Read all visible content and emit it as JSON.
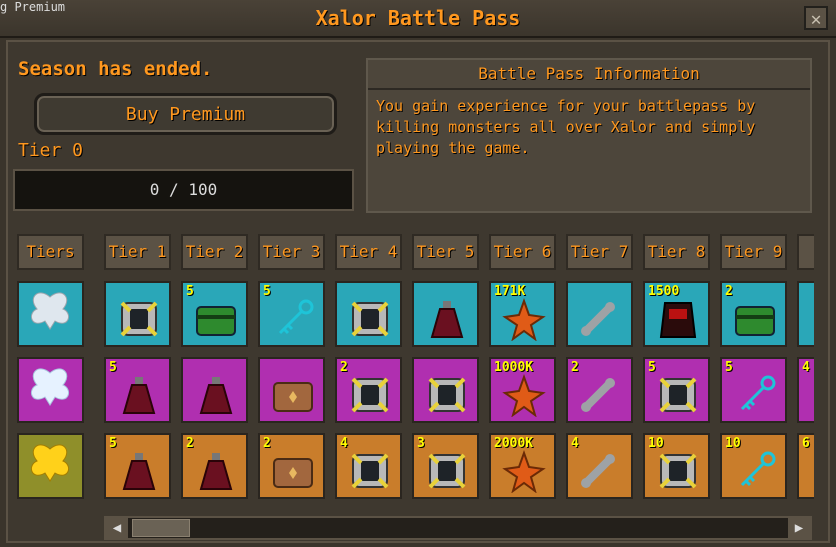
{
  "window": {
    "top_text": "g Premium",
    "title": "Xalor Battle Pass",
    "close_label": "✕"
  },
  "status": {
    "season_text": "Season has ended.",
    "buy_label": "Buy Premium",
    "tier_label": "Tier 0"
  },
  "progress": {
    "text": "0 / 100",
    "fraction": 0
  },
  "info": {
    "title": "Battle Pass Information",
    "body": "You gain experience for your battlepass by killing monsters all over Xalor and simply playing the game."
  },
  "headers": [
    "Tiers",
    "Tier 1",
    "Tier 2",
    "Tier 3",
    "Tier 4",
    "Tier 5",
    "Tier 6",
    "Tier 7",
    "Tier 8",
    "Tier 9",
    "T"
  ],
  "rows": [
    {
      "name": "free",
      "cells": [
        {
          "icon": "box-icon",
          "count": ""
        },
        {
          "icon": "chest-icon",
          "count": "5"
        },
        {
          "icon": "key-icon",
          "count": "5"
        },
        {
          "icon": "box-icon",
          "count": ""
        },
        {
          "icon": "potion-icon",
          "count": ""
        },
        {
          "icon": "star-icon",
          "count": "171K"
        },
        {
          "icon": "bone-icon",
          "count": ""
        },
        {
          "icon": "armor-icon",
          "count": "1500"
        },
        {
          "icon": "chest-icon",
          "count": "2"
        },
        {
          "icon": "item-icon",
          "count": ""
        }
      ]
    },
    {
      "name": "premium",
      "cells": [
        {
          "icon": "potion-icon",
          "count": "5"
        },
        {
          "icon": "potion-icon",
          "count": ""
        },
        {
          "icon": "crate-icon",
          "count": ""
        },
        {
          "icon": "box-icon",
          "count": "2"
        },
        {
          "icon": "box-icon",
          "count": ""
        },
        {
          "icon": "star-icon",
          "count": "1000K"
        },
        {
          "icon": "bone-icon",
          "count": "2"
        },
        {
          "icon": "box-icon",
          "count": "5"
        },
        {
          "icon": "key-icon",
          "count": "5"
        },
        {
          "icon": "item-icon",
          "count": "4"
        }
      ]
    },
    {
      "name": "gold",
      "cells": [
        {
          "icon": "potion-icon",
          "count": "5"
        },
        {
          "icon": "potion-icon",
          "count": "2"
        },
        {
          "icon": "crate-icon",
          "count": "2"
        },
        {
          "icon": "box-icon",
          "count": "4"
        },
        {
          "icon": "box-icon",
          "count": "3"
        },
        {
          "icon": "star-icon",
          "count": "2000K"
        },
        {
          "icon": "bone-icon",
          "count": "4"
        },
        {
          "icon": "box-icon",
          "count": "10"
        },
        {
          "icon": "key-icon",
          "count": "10"
        },
        {
          "icon": "item-icon",
          "count": "6"
        }
      ]
    }
  ],
  "colors": {
    "accent": "#ff981f",
    "free": "#2aa7b8",
    "premium": "#b02fb0",
    "gold": "#c97d2b"
  }
}
